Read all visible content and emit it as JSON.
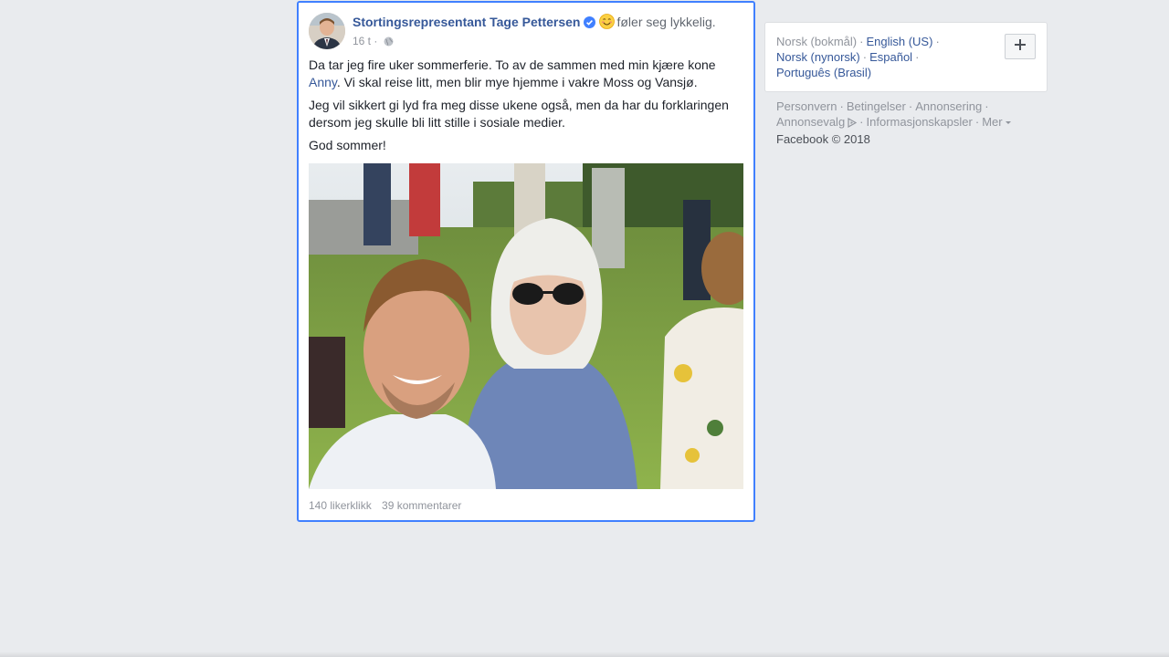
{
  "post": {
    "author": "Stortingsrepresentant Tage Pettersen",
    "feeling": "føler seg lykkelig.",
    "time": "16 t",
    "dot": "·",
    "body": {
      "p1_before": "Da tar jeg fire uker sommerferie. To av de sammen med min kjære kone ",
      "p1_link": "Anny",
      "p1_after": ". Vi skal reise litt, men blir mye hjemme i vakre Moss og Vansjø.",
      "p2": "Jeg vil sikkert gi lyd fra meg disse ukene også, men da har du forklaringen dersom jeg skulle bli litt stille i sosiale medier.",
      "p3": "God sommer!"
    },
    "likes": "140 likerklikk",
    "comments": "39 kommentarer"
  },
  "languages": {
    "current": "Norsk (bokmål)",
    "options": [
      "English (US)",
      "Norsk (nynorsk)",
      "Español",
      "Português (Brasil)"
    ],
    "separator": "·"
  },
  "footer": {
    "links": [
      "Personvern",
      "Betingelser",
      "Annonsering",
      "Annonsevalg",
      "Informasjonskapsler",
      "Mer"
    ],
    "separator": "·",
    "copyright": "Facebook © 2018"
  },
  "colors": {
    "link": "#365899",
    "highlight_border": "#4080ff",
    "background": "#e9ebee",
    "verified": "#4080ff"
  },
  "icons": {
    "verified": "verified-badge-icon",
    "emoji": "smiling-face-emoji-icon",
    "privacy": "globe-icon",
    "plus": "plus-icon",
    "adchoices": "adchoices-icon"
  }
}
